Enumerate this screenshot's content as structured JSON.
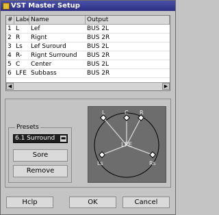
{
  "window": {
    "title": "VST Master Setup"
  },
  "table": {
    "headers": [
      "#",
      "Labe",
      "Name",
      "Output"
    ],
    "rows": [
      [
        "1",
        "L",
        "Lef",
        "BUS 2L"
      ],
      [
        "2",
        "R",
        "Rignt",
        "BUS 2R"
      ],
      [
        "3",
        "Ls",
        "Lef Surourd",
        "BUS 2L"
      ],
      [
        "4",
        "R-",
        "Rignt Surround",
        "BUS 2R"
      ],
      [
        "5",
        "C",
        "Center",
        "BUS 2L"
      ],
      [
        "6",
        "LFE",
        "Subbass",
        "BUS 2R"
      ]
    ]
  },
  "presets": {
    "label": "Presets",
    "selected": "6.1 Surround",
    "store_label": "Sore",
    "remove_label": "Remove"
  },
  "speakers": {
    "L": "L",
    "C": "C",
    "R": "R",
    "LFE": "LFE",
    "Ls": "Ls",
    "Rs": "Rs"
  },
  "buttons": {
    "help": "Hclp",
    "ok": "OK",
    "cancel": "Cancel"
  },
  "colors": {
    "title_bar": "#2c2f82",
    "speaker_bg": "#6d6d6d",
    "table_bg": "#ffffff"
  }
}
